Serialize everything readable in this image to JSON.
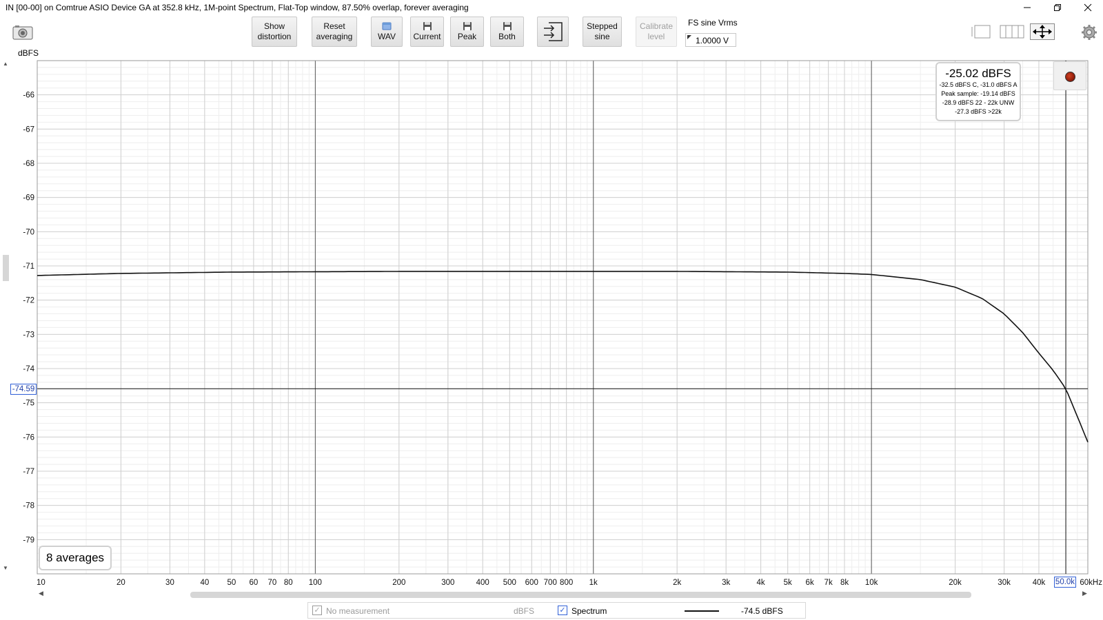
{
  "window": {
    "title": "IN [00-00] on Comtrue ASIO Device GA at 352.8 kHz, 1M-point Spectrum, Flat-Top window, 87.50% overlap, forever averaging"
  },
  "toolbar": {
    "show_distortion": [
      "Show",
      "distortion"
    ],
    "reset_averaging": [
      "Reset",
      "averaging"
    ],
    "wav": "WAV",
    "current": "Current",
    "peak": "Peak",
    "both": "Both",
    "stepped_sine": [
      "Stepped",
      "sine"
    ],
    "calibrate_level": [
      "Calibrate",
      "level"
    ],
    "fs_label": "FS sine Vrms",
    "fs_value": "1.0000 V"
  },
  "plot": {
    "unit_label": "dBFS",
    "cursor_y": "-74.59",
    "cursor_x": "50.0k",
    "averages": "8 averages",
    "readout": {
      "main": "-25.02 dBFS",
      "lines": [
        "-32.5 dBFS C, -31.0 dBFS A",
        "Peak sample: -19.14 dBFS",
        "-28.9 dBFS 22 - 22k UNW",
        "-27.3 dBFS >22k"
      ]
    }
  },
  "legend": {
    "no_measurement": "No measurement",
    "unit": "dBFS",
    "spectrum": "Spectrum",
    "value": "-74.5 dBFS"
  },
  "chart_data": {
    "type": "line",
    "x_scale": "log",
    "xlim": [
      10,
      60000
    ],
    "ylim": [
      -80,
      -65
    ],
    "ylabel": "dBFS",
    "x_ticks": [
      10,
      20,
      30,
      40,
      50,
      60,
      70,
      80,
      100,
      200,
      300,
      400,
      500,
      600,
      700,
      800,
      1000,
      2000,
      3000,
      4000,
      5000,
      6000,
      7000,
      8000,
      10000,
      20000,
      30000,
      40000,
      50000,
      60000
    ],
    "x_tick_labels": [
      "10",
      "20",
      "30",
      "40",
      "50",
      "60",
      "70",
      "80",
      "100",
      "200",
      "300",
      "400",
      "500",
      "600",
      "700",
      "800",
      "1k",
      "2k",
      "3k",
      "4k",
      "5k",
      "6k",
      "7k",
      "8k",
      "10k",
      "20k",
      "30k",
      "40k",
      "50.0k",
      "60kHz"
    ],
    "y_ticks": [
      -66,
      -67,
      -68,
      -69,
      -70,
      -71,
      -72,
      -73,
      -74,
      -75,
      -76,
      -77,
      -78,
      -79
    ],
    "grid": true,
    "cursor": {
      "x": 50000,
      "y": -74.59
    },
    "series": [
      {
        "x": [
          10,
          20,
          50,
          100,
          200,
          500,
          1000,
          2000,
          5000,
          8000,
          10000,
          15000,
          20000,
          25000,
          30000,
          35000,
          40000,
          45000,
          50000,
          55000,
          60000
        ],
        "y": [
          -71.28,
          -71.22,
          -71.18,
          -71.17,
          -71.16,
          -71.16,
          -71.16,
          -71.16,
          -71.18,
          -71.22,
          -71.25,
          -71.4,
          -71.62,
          -71.95,
          -72.4,
          -72.95,
          -73.55,
          -74.05,
          -74.59,
          -75.4,
          -76.15
        ]
      }
    ]
  }
}
